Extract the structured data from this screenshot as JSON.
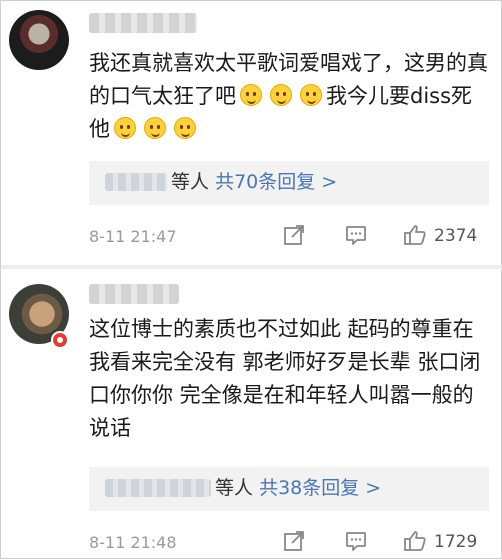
{
  "comments": [
    {
      "body": [
        "我还真就喜欢太平歌词爱唱戏了，这男的真的口气太狂了吧",
        "我今儿要diss死他"
      ],
      "reply": {
        "suffix": "等人",
        "count_text": "共70条回复 >"
      },
      "timestamp": "8-11 21:47",
      "likes": "2374",
      "emoji": "face-emoji"
    },
    {
      "body": [
        "这位博士的素质也不过如此 起码的尊重在我看来完全没有 郭老师好歹是长辈 张口闭口你你你 完全像是在和年轻人叫嚣一般的说话"
      ],
      "reply": {
        "suffix": "等人",
        "count_text": "共38条回复 >"
      },
      "timestamp": "8-11 21:48",
      "likes": "1729"
    }
  ],
  "colors": {
    "link": "#4a76b4",
    "badge": "#e63b2e",
    "reply_bg": "#f2f2f2"
  }
}
